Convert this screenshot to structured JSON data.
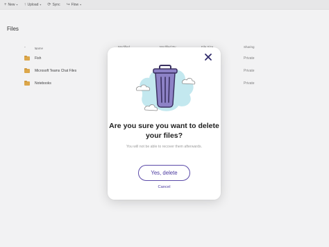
{
  "command_bar": {
    "items": [
      {
        "icon": "plus-icon",
        "label": "New",
        "has_dropdown": true
      },
      {
        "icon": "upload-icon",
        "label": "Upload",
        "has_dropdown": true
      },
      {
        "icon": "sync-icon",
        "label": "Sync",
        "has_dropdown": false
      },
      {
        "icon": "flow-icon",
        "label": "Flow",
        "has_dropdown": true
      }
    ]
  },
  "page": {
    "title": "Files"
  },
  "file_table": {
    "header": {
      "name": "Name",
      "modified": "Modified",
      "modified_by": "Modified By",
      "file_size": "File Size",
      "sharing": "Sharing"
    },
    "rows": [
      {
        "name": "Fish",
        "sharing": "Private"
      },
      {
        "name": "Microsoft Teams Chat Files",
        "sharing": "Private"
      },
      {
        "name": "Notebooks",
        "sharing": "Private"
      }
    ]
  },
  "dialog": {
    "title": "Are you sure you want to delete your files?",
    "subtitle": "You will not be able to recover them afterwards.",
    "confirm_label": "Yes, delete",
    "cancel_label": "Cancel",
    "illustration": "trash-can-icon",
    "close_icon": "close-icon"
  },
  "colors": {
    "accent": "#4b3aa0",
    "trash_body": "#8d82c6",
    "cloud_blob": "#c3e8ef",
    "folder": "#e8b04c",
    "command_bar_bg": "#f4f4f4"
  }
}
